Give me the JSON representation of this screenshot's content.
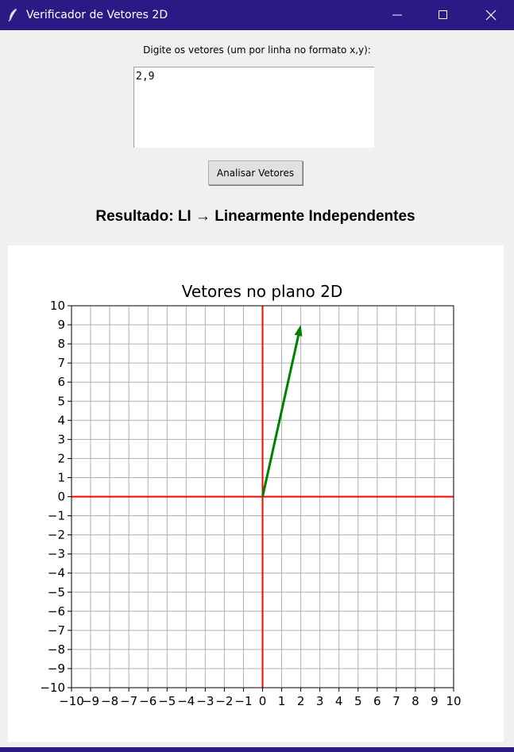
{
  "window": {
    "title": "Verificador de Vetores 2D",
    "titlebar_color": "#2b1a86",
    "controls": [
      "minimize-icon",
      "maximize-icon",
      "close-icon"
    ]
  },
  "input": {
    "prompt": "Digite os vetores (um por linha no formato x,y):",
    "value": "2,9"
  },
  "analyze_button": {
    "label": "Analisar Vetores"
  },
  "result": {
    "text": "Resultado: LI → Linearmente Independentes"
  },
  "chart_data": {
    "type": "vector",
    "title": "Vetores no plano 2D",
    "xlim": [
      -10,
      10
    ],
    "ylim": [
      -10,
      10
    ],
    "x_ticks": [
      "−10",
      "−9",
      "−8",
      "−7",
      "−6",
      "−5",
      "−4",
      "−3",
      "−2",
      "−1",
      "0",
      "1",
      "2",
      "3",
      "4",
      "5",
      "6",
      "7",
      "8",
      "9",
      "10"
    ],
    "y_ticks": [
      "−10",
      "−9",
      "−8",
      "−7",
      "−6",
      "−5",
      "−4",
      "−3",
      "−2",
      "−1",
      "0",
      "1",
      "2",
      "3",
      "4",
      "5",
      "6",
      "7",
      "8",
      "9",
      "10"
    ],
    "grid": true,
    "axis_lines": {
      "color": "#ff0000"
    },
    "vectors": [
      {
        "origin": [
          0,
          0
        ],
        "x": 2,
        "y": 9,
        "color": "#008000"
      }
    ]
  }
}
